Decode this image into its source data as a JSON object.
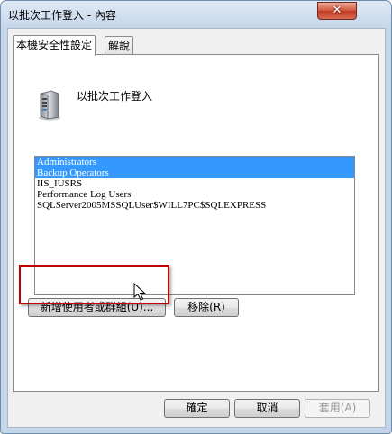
{
  "window": {
    "title": "以批次工作登入 - 內容",
    "close_glyph": "✕"
  },
  "tabs": [
    {
      "label": "本機安全性設定",
      "active": true
    },
    {
      "label": "解說",
      "active": false
    }
  ],
  "policy": {
    "name": "以批次工作登入",
    "icon": "server-computer-icon"
  },
  "members": [
    {
      "name": "Administrators",
      "selected": true
    },
    {
      "name": "Backup Operators",
      "selected": true
    },
    {
      "name": "IIS_IUSRS",
      "selected": false
    },
    {
      "name": "Performance Log Users",
      "selected": false
    },
    {
      "name": "SQLServer2005MSSQLUser$WILL7PC$SQLEXPRESS",
      "selected": false
    }
  ],
  "buttons": {
    "add": "新增使用者或群組(U)...",
    "remove": "移除(R)",
    "ok": "確定",
    "cancel": "取消",
    "apply": "套用(A)"
  },
  "colors": {
    "selection": "#3399ff",
    "highlight_box": "#c00000"
  }
}
